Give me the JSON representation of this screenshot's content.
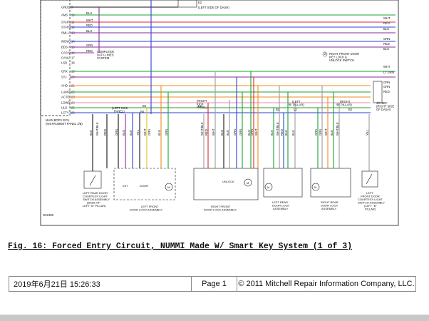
{
  "diagram": {
    "id_code": "G62488",
    "left_conn_labels": [
      "GND2",
      "AMS",
      "STAR1",
      "STAR2",
      "SMLL",
      "INDW",
      "BDSI",
      "CASH",
      "CANL",
      "LSD",
      "CRX",
      "STJ",
      "AHD",
      "LUMP",
      "ACTD",
      "LDWD",
      "ULD",
      "LCTY"
    ],
    "left_wire_colors": [
      "",
      "BLU",
      "WHT",
      "RED",
      "BLU",
      "",
      "GRN",
      "RED",
      "",
      "",
      "",
      "",
      "",
      "",
      "",
      "",
      "",
      ""
    ],
    "left_pins": [
      "9",
      "10",
      "11",
      "12",
      "13",
      "14",
      "15",
      "16",
      "17",
      "18",
      "19",
      "20",
      "21",
      "22",
      "23",
      "24",
      "25",
      "26"
    ],
    "main_body_ecu": "MAIN BODY ECU\n(INSTRUMENT PANEL J/B)",
    "top_note": "(LEFT SIDE OF DASH)",
    "top_note_code": "E2",
    "can_note": "COMPUTER\nDATA LINES\nSYSTEM",
    "switch_note": "RIGHT FRONT DOOR\nKEY LOCK &\nUNLOCK SWITCH",
    "switch_note_num": "2",
    "junction_note": "J/C BEF\n(RIGHT SIDE\nOF DASH)",
    "right_wire_colors": [
      "WHT",
      "RED",
      "BLU",
      "GRN",
      "RED",
      "BLU",
      "WHT",
      "LT GRN",
      "GRN",
      "GRN",
      "RED"
    ],
    "right_pin_labels": [
      "",
      "",
      "",
      "",
      "",
      "",
      "",
      "",
      "GRN 8A",
      "GRN 7A",
      "GRN 8A"
    ],
    "kick_panel_left": "(LEFT KICK\nPANEL)",
    "kick_panel_right": "(RIGHT\nKICK\nPANEL)",
    "pillar_left": "(LEFT\n\"B\" PILLAR)",
    "pillar_right": "(RIGHT\n\"B\" PILLAR)",
    "conn_codes": [
      "B4",
      "B5",
      "E2",
      "B2",
      "L2",
      "B2"
    ],
    "vertical_wire_labels": [
      "BLK",
      "WHT/BLK",
      "RED",
      "GRN",
      "BLU",
      "BLK",
      "YEL",
      "WHT",
      "GRN",
      "BLU",
      "GRN",
      "WHT/BLK",
      "RED",
      "WHT",
      "BLU",
      "BLK",
      "GRN",
      "GRN",
      "BLU",
      "GRN",
      "WHT",
      "BLK",
      "WHT/BLK",
      "RED",
      "BLK",
      "BLK",
      "GRN",
      "GRN",
      "WHT",
      "BLK",
      "WHT/BLK",
      "YEL"
    ],
    "components": [
      {
        "name": "LEFT REAR DOOR\nCOURTESY LIGHT\nSWITCH ASSEMBLY\n(BASE OF\nLEFT \"B\" PILLAR)"
      },
      {
        "name": "LEFT FRONT\nDOOR LOCK ASSEMBLY"
      },
      {
        "name": "RIGHT FRONT\nDOOR LOCK ASSEMBLY"
      },
      {
        "name": "LEFT REAR\nDOOR LOCK\nASSEMBLY"
      },
      {
        "name": "RIGHT REAR\nDOOR LOCK\nASSEMBLY"
      },
      {
        "name": "LEFT\nFRONT DOOR\nCOURTESY LIGHT\nSWITCH ASSEMBLY\n(LEFT \"B\"\nPILLAR)"
      }
    ],
    "inner_labels": [
      "KEY\nUNLOCK",
      "DOOR\nLOCK",
      "UNLOCK\nDETECTION",
      "M",
      "UNLOCK\nDETECTION",
      "M",
      "UNLOCK\nDETECTION",
      "M",
      "UNLOCK\nDETECTION",
      "M"
    ],
    "colors": {
      "blue": "#2a3fd6",
      "green": "#1aa32e",
      "red": "#e0262b",
      "purple": "#8a2a9a",
      "orange": "#f08a1c",
      "yellow": "#e0c21a",
      "black": "#111111",
      "grey": "#9a9a9a",
      "pink": "#e88ab0"
    }
  },
  "caption": "Fig. 16: Forced Entry Circuit, NUMMI Made W/ Smart Key System (1 of 3)",
  "footer": {
    "date": "2019年6月21日  15:26:33",
    "page": "Page 1",
    "copyright": "© 2011 Mitchell Repair Information Company, LLC."
  }
}
